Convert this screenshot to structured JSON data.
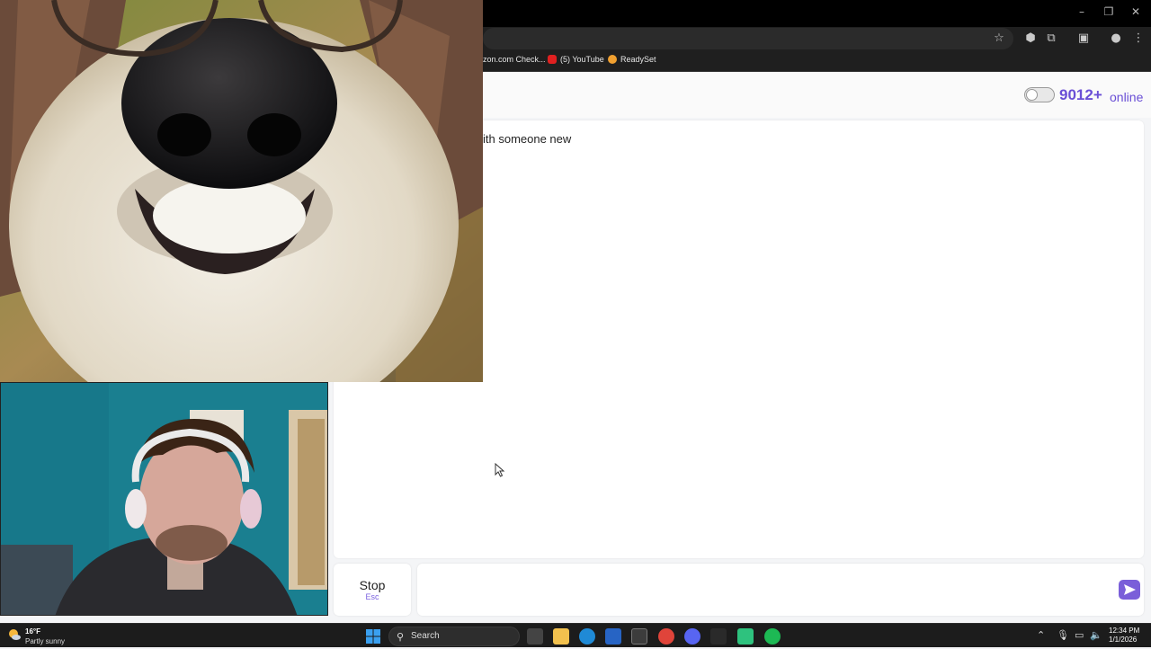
{
  "browser": {
    "bookmarks": [
      {
        "label": "zon.com Check..."
      },
      {
        "label": "(5) YouTube"
      },
      {
        "label": "ReadySet"
      }
    ]
  },
  "header": {
    "online_count": "9012+",
    "online_label": "online"
  },
  "chat": {
    "message": "ith someone new",
    "input_value": ""
  },
  "controls": {
    "stop_label": "Stop",
    "stop_hint": "Esc"
  },
  "taskbar": {
    "weather_temp": "16°F",
    "weather_desc": "Partly sunny",
    "search_label": "Search",
    "time": "12:34 PM",
    "date": "1/1/2026"
  },
  "colors": {
    "accent": "#6a4fd6"
  }
}
